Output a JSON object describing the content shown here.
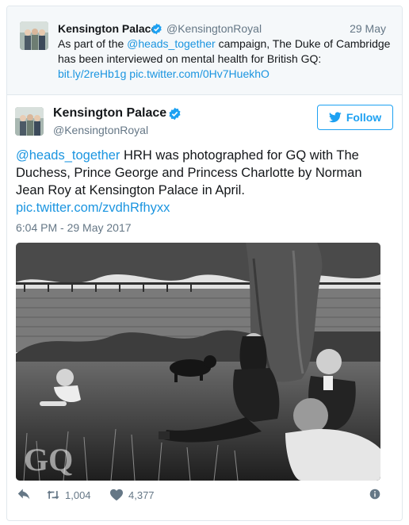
{
  "parent_tweet": {
    "author_name": "Kensington Palace",
    "handle": "@KensingtonRoyal",
    "date": "29 May",
    "text_before": "As part of the ",
    "mention": "@heads_together",
    "text_after": " campaign, The Duke of Cambridge has been interviewed on mental health for British GQ: ",
    "link1": "bit.ly/2reHb1g",
    "link2": "pic.twitter.com/0Hv7HuekhO"
  },
  "tweet": {
    "author_name": "Kensington Palace",
    "handle": "@KensingtonRoyal",
    "follow_label": "Follow",
    "mention": "@heads_together",
    "text": " HRH was photographed for GQ with The Duchess, Prince George and Princess Charlotte by Norman Jean Roy at Kensington Palace in April.",
    "pic_link": "pic.twitter.com/zvdhRfhyxx",
    "timestamp": "6:04 PM - 29 May 2017",
    "photo_watermark": "GQ",
    "retweet_count": "1,004",
    "like_count": "4,377"
  },
  "colors": {
    "link": "#1b95e0",
    "follow_accent": "#1da1f2",
    "verified": "#1da1f2",
    "secondary_text": "#657786"
  },
  "icons": [
    "verified-badge-icon",
    "twitter-bird-icon",
    "reply-icon",
    "retweet-icon",
    "heart-icon",
    "info-icon"
  ]
}
